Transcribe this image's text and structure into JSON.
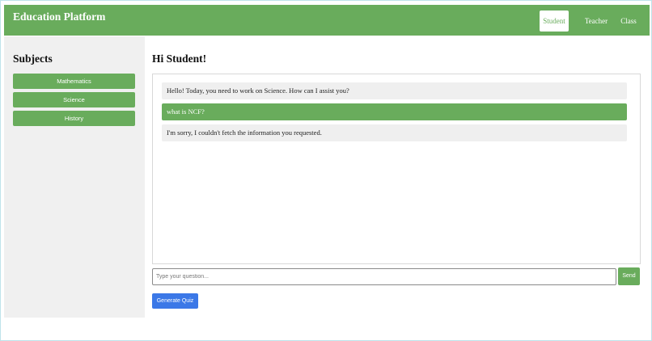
{
  "header": {
    "brand": "Education Platform",
    "nav": [
      {
        "label": "Student",
        "active": true
      },
      {
        "label": "Teacher",
        "active": false
      },
      {
        "label": "Class",
        "active": false
      }
    ]
  },
  "sidebar": {
    "title": "Subjects",
    "subjects": [
      {
        "label": "Mathematics"
      },
      {
        "label": "Science"
      },
      {
        "label": "History"
      }
    ]
  },
  "main": {
    "greeting": "Hi Student!",
    "messages": [
      {
        "role": "bot",
        "text": "Hello! Today, you need to work on Science. How can I assist you?"
      },
      {
        "role": "user",
        "text": "what is NCF?"
      },
      {
        "role": "bot",
        "text": "I'm sorry, I couldn't fetch the information you requested."
      }
    ],
    "input": {
      "placeholder": "Type your question...",
      "value": ""
    },
    "send_label": "Send",
    "quiz_label": "Generate Quiz"
  },
  "colors": {
    "primary_green": "#69ac5c",
    "quiz_blue": "#3b78e7",
    "sidebar_bg": "#f0f0f0",
    "bot_bubble": "#efefef"
  }
}
